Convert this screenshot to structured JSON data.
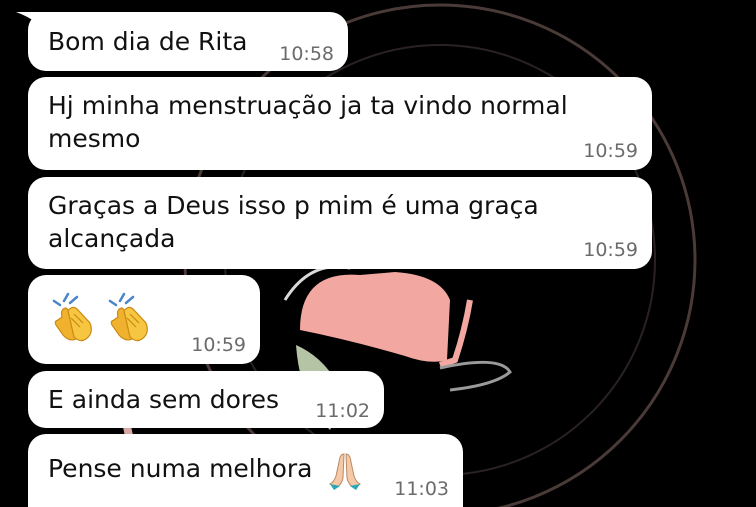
{
  "chat": {
    "messages": [
      {
        "text": "Bom dia de Rita",
        "time": "10:58"
      },
      {
        "text": "Hj minha menstruação ja ta vindo normal\nmesmo",
        "time": "10:59"
      },
      {
        "text": "Graças a Deus isso p mim é uma graça\nalcançada",
        "time": "10:59"
      },
      {
        "emojis": [
          "clapping-hands",
          "clapping-hands"
        ],
        "time": "10:59"
      },
      {
        "text": "E ainda sem dores",
        "time": "11:02"
      },
      {
        "text": "Pense numa melhora",
        "emoji": "folded-hands",
        "time": "11:03"
      }
    ]
  },
  "theme": {
    "background": "#000000",
    "bubble": "#ffffff",
    "text": "#111111",
    "timestamp": "#6b6b6b"
  }
}
